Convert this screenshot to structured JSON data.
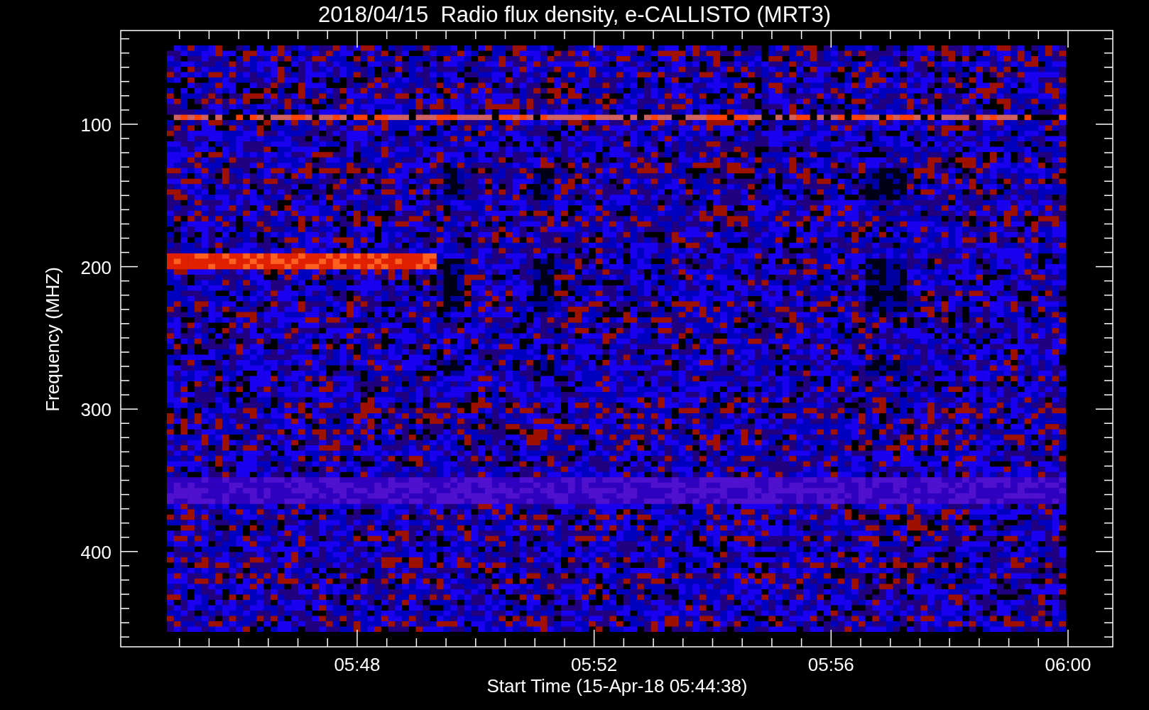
{
  "title": "2018/04/15  Radio flux density, e-CALLISTO (MRT3)",
  "y_axis": {
    "label": "Frequency (MHZ)",
    "ticks": [
      "100",
      "200",
      "300",
      "400"
    ]
  },
  "x_axis": {
    "label": "Start Time (15-Apr-18 05:44:38)",
    "ticks": [
      "05:48",
      "05:52",
      "05:56",
      "06:00"
    ]
  }
}
